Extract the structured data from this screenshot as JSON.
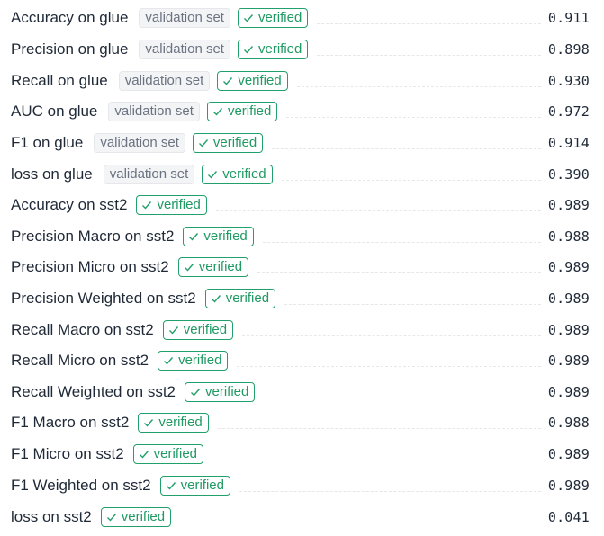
{
  "metrics": [
    {
      "label": "Accuracy on glue",
      "split": "validation set",
      "verified": "verified",
      "value": "0.911"
    },
    {
      "label": "Precision on glue",
      "split": "validation set",
      "verified": "verified",
      "value": "0.898"
    },
    {
      "label": "Recall on glue",
      "split": "validation set",
      "verified": "verified",
      "value": "0.930"
    },
    {
      "label": "AUC on glue",
      "split": "validation set",
      "verified": "verified",
      "value": "0.972"
    },
    {
      "label": "F1 on glue",
      "split": "validation set",
      "verified": "verified",
      "value": "0.914"
    },
    {
      "label": "loss on glue",
      "split": "validation set",
      "verified": "verified",
      "value": "0.390"
    },
    {
      "label": "Accuracy on sst2",
      "verified": "verified",
      "value": "0.989"
    },
    {
      "label": "Precision Macro on sst2",
      "verified": "verified",
      "value": "0.988"
    },
    {
      "label": "Precision Micro on sst2",
      "verified": "verified",
      "value": "0.989"
    },
    {
      "label": "Precision Weighted on sst2",
      "verified": "verified",
      "value": "0.989"
    },
    {
      "label": "Recall Macro on sst2",
      "verified": "verified",
      "value": "0.989"
    },
    {
      "label": "Recall Micro on sst2",
      "verified": "verified",
      "value": "0.989"
    },
    {
      "label": "Recall Weighted on sst2",
      "verified": "verified",
      "value": "0.989"
    },
    {
      "label": "F1 Macro on sst2",
      "verified": "verified",
      "value": "0.988"
    },
    {
      "label": "F1 Micro on sst2",
      "verified": "verified",
      "value": "0.989"
    },
    {
      "label": "F1 Weighted on sst2",
      "verified": "verified",
      "value": "0.989"
    },
    {
      "label": "loss on sst2",
      "verified": "verified",
      "value": "0.041"
    }
  ],
  "icons": {
    "verified": "check-icon"
  },
  "colors": {
    "verified_border": "#22a06b",
    "verified_text": "#1f9a63",
    "split_bg": "#f3f4f6",
    "split_text": "#6b7280"
  }
}
